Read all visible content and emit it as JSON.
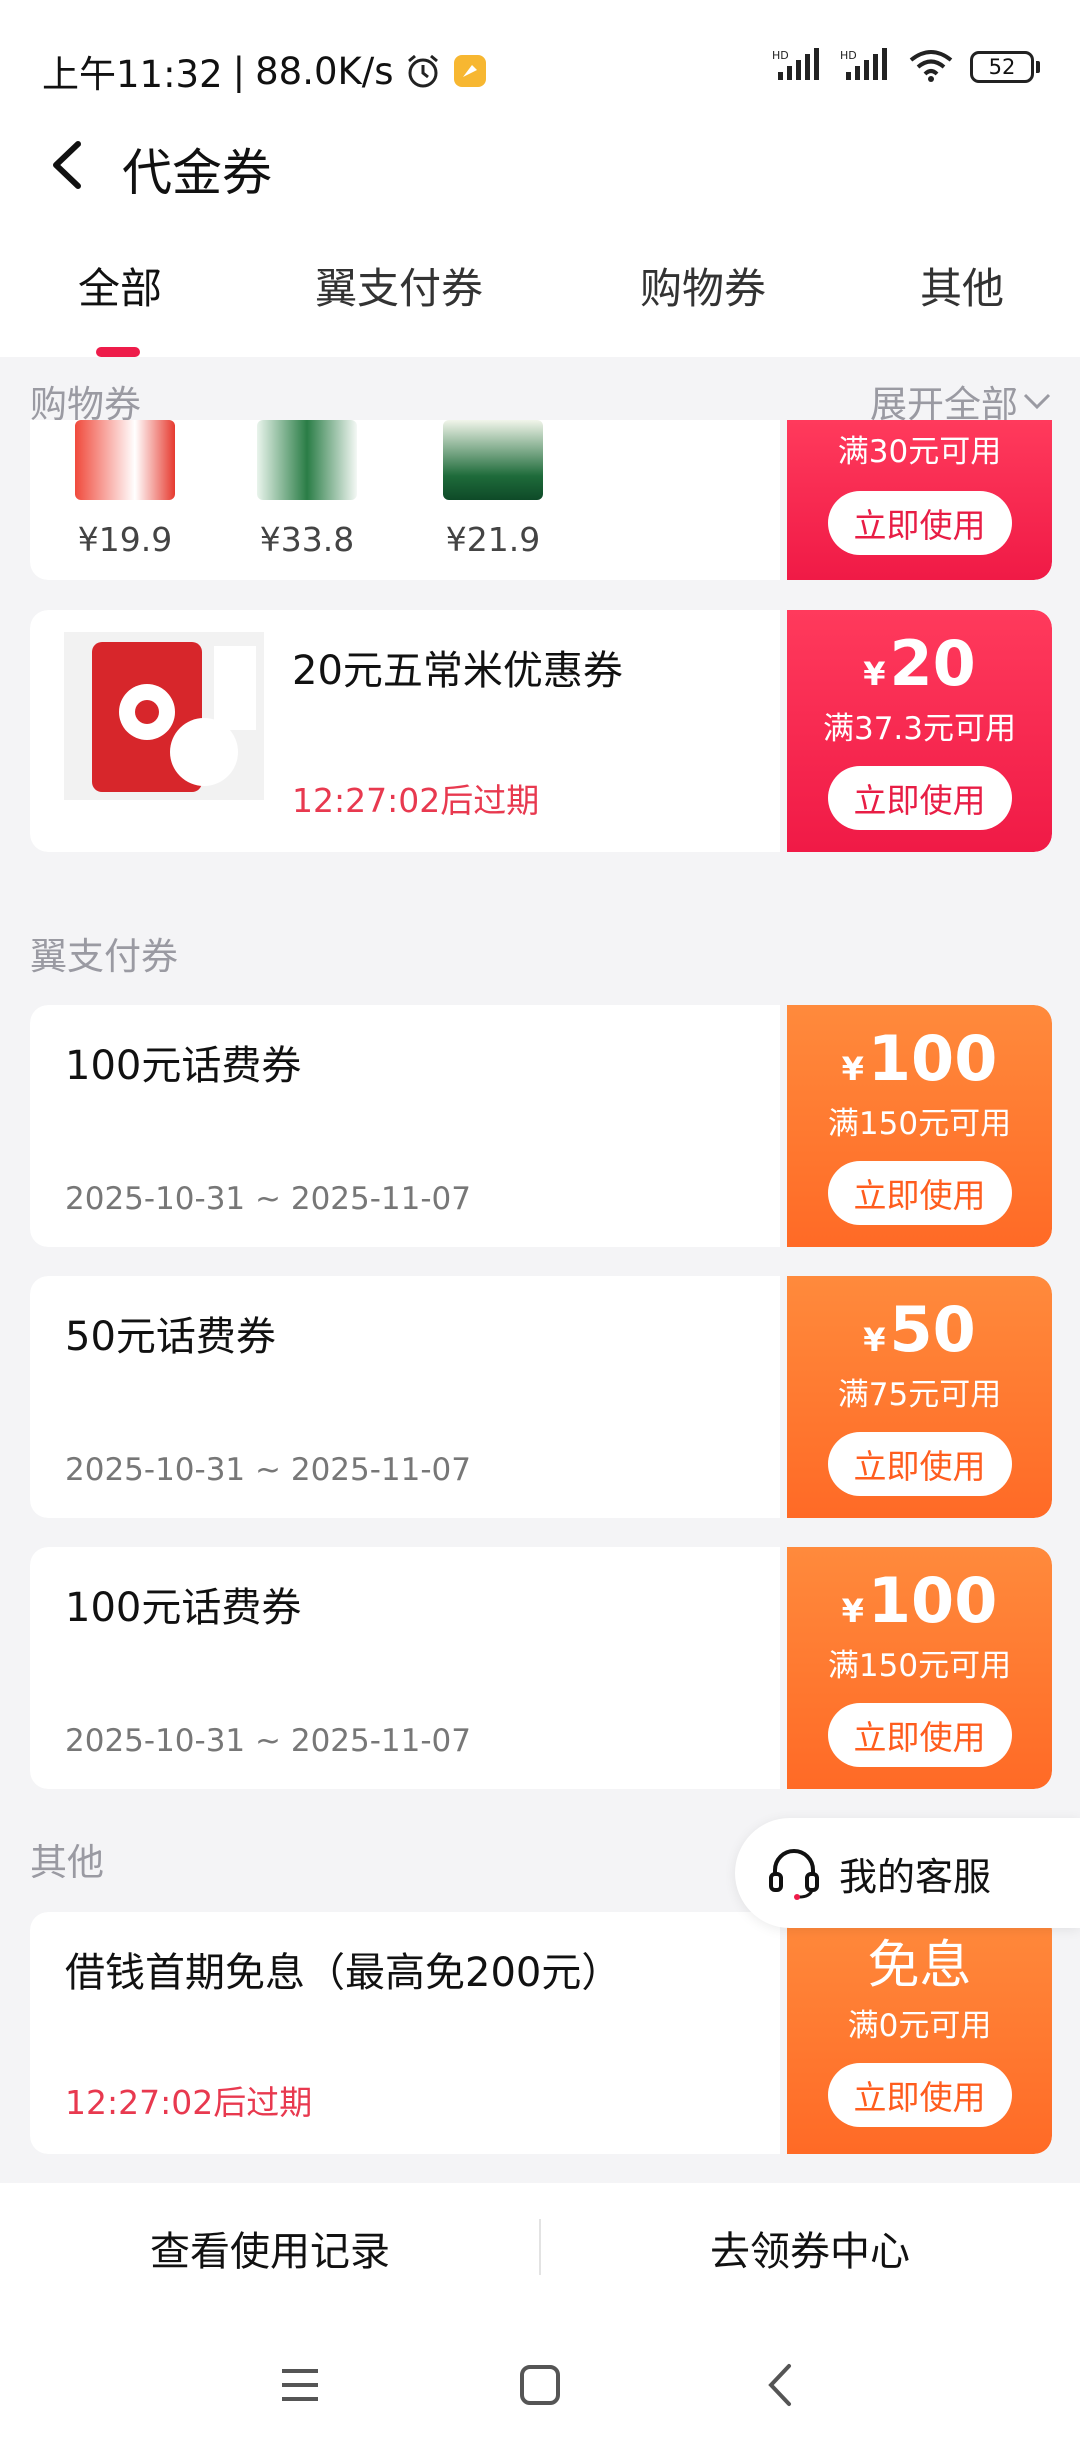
{
  "status_bar": {
    "time": "上午11:32",
    "speed": "88.0K/s",
    "battery": "52"
  },
  "header": {
    "title": "代金券"
  },
  "tabs": [
    {
      "label": "全部",
      "active": true
    },
    {
      "label": "翼支付券",
      "active": false
    },
    {
      "label": "购物券",
      "active": false
    },
    {
      "label": "其他",
      "active": false
    }
  ],
  "sections": {
    "shopping": {
      "title": "购物券",
      "expand_label": "展开全部"
    },
    "yizhifu": {
      "title": "翼支付券"
    },
    "other": {
      "title": "其他"
    }
  },
  "shopping_products": [
    {
      "price": "¥19.9"
    },
    {
      "price": "¥33.8"
    },
    {
      "price": "¥21.9"
    }
  ],
  "coupons": [
    {
      "condition": "满30元可用",
      "button": "立即使用"
    },
    {
      "name": "20元五常米优惠券",
      "expire": "12:27:02后过期",
      "yen": "¥",
      "amount": "20",
      "condition": "满37.3元可用",
      "button": "立即使用"
    },
    {
      "name": "100元话费券",
      "date": "2025-10-31 ~ 2025-11-07",
      "yen": "¥",
      "amount": "100",
      "condition": "满150元可用",
      "button": "立即使用"
    },
    {
      "name": "50元话费券",
      "date": "2025-10-31 ~ 2025-11-07",
      "yen": "¥",
      "amount": "50",
      "condition": "满75元可用",
      "button": "立即使用"
    },
    {
      "name": "100元话费券",
      "date": "2025-10-31 ~ 2025-11-07",
      "yen": "¥",
      "amount": "100",
      "condition": "满150元可用",
      "button": "立即使用"
    },
    {
      "name": "借钱首期免息（最高免200元）",
      "expire": "12:27:02后过期",
      "amount_word": "免息",
      "condition": "满0元可用",
      "button": "立即使用"
    }
  ],
  "service": {
    "label": "我的客服"
  },
  "bottom_bar": {
    "history": "查看使用记录",
    "center": "去领券中心"
  },
  "colors": {
    "accent_red": "#ee1c4a",
    "orange": "#ff6a26",
    "expire_red": "#e8394f"
  }
}
